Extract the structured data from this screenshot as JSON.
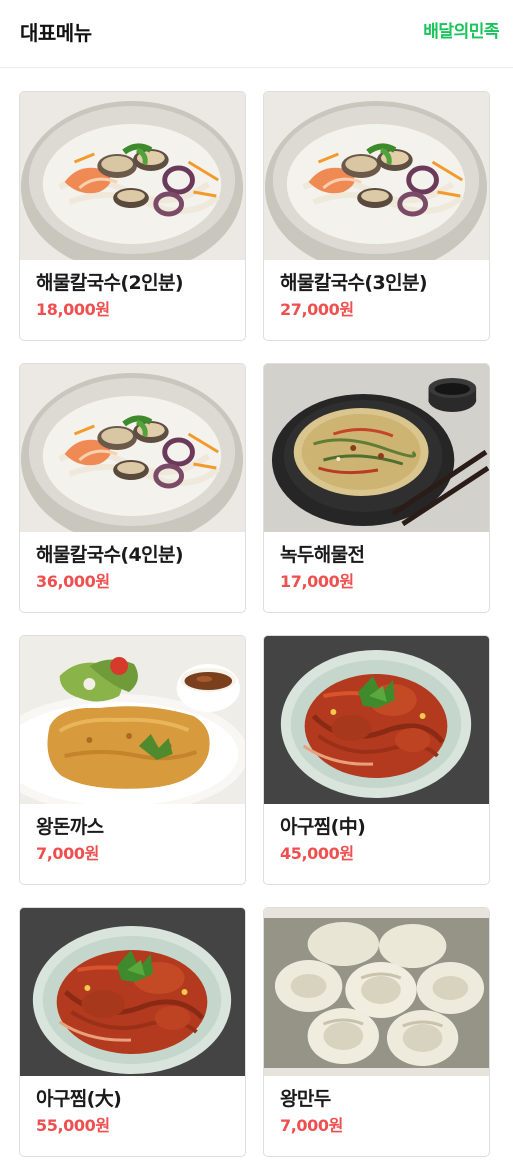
{
  "header": {
    "title": "대표메뉴",
    "brand_link": "배달의민족",
    "brand_color": "#18c35a"
  },
  "menu": {
    "items": [
      {
        "name": "해물칼국수(2인분)",
        "price": "18,000원",
        "image": "seafood-kalguksu-photo"
      },
      {
        "name": "해물칼국수(3인분)",
        "price": "27,000원",
        "image": "seafood-kalguksu-photo"
      },
      {
        "name": "해물칼국수(4인분)",
        "price": "36,000원",
        "image": "seafood-kalguksu-photo"
      },
      {
        "name": "녹두해물전",
        "price": "17,000원",
        "image": "mungbean-seafood-pancake-photo"
      },
      {
        "name": "왕돈까스",
        "price": "7,000원",
        "image": "pork-cutlet-photo"
      },
      {
        "name": "아구찜(中)",
        "price": "45,000원",
        "image": "braised-monkfish-photo"
      },
      {
        "name": "아구찜(大)",
        "price": "55,000원",
        "image": "braised-monkfish-photo"
      },
      {
        "name": "왕만두",
        "price": "7,000원",
        "image": "dumplings-photo"
      }
    ]
  },
  "colors": {
    "price": "#ef4f4f",
    "name": "#1a1a1a"
  }
}
